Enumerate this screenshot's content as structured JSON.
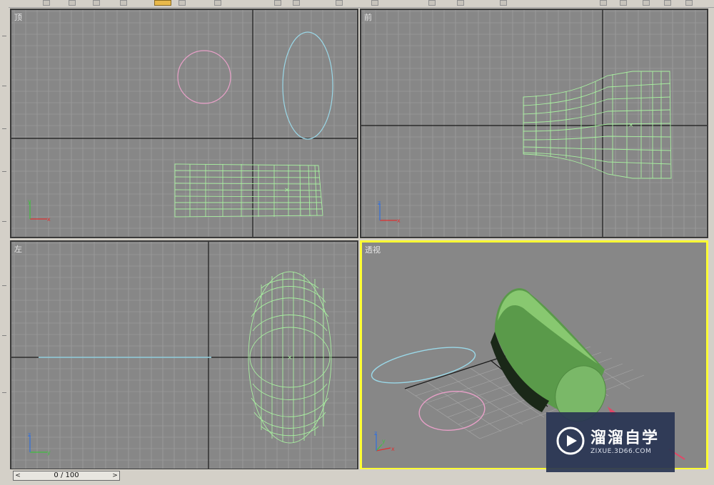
{
  "viewports": {
    "top": {
      "label": "顶"
    },
    "front": {
      "label": "前"
    },
    "left": {
      "label": "左"
    },
    "perspective": {
      "label": "透视"
    }
  },
  "axis_labels": {
    "x": "x",
    "y": "y",
    "z": "z"
  },
  "timeline": {
    "frame_display": "0 / 100",
    "prev_label": "<",
    "next_label": ">"
  },
  "watermark": {
    "brand": "溜溜自学",
    "url": "ZIXUE.3D66.COM"
  },
  "colors": {
    "active_viewport": "#ffff33",
    "viewport_bg": "#878787",
    "mesh": "#a8f0a0",
    "ellipse": "#9ad8e8",
    "circle": "#e8a0c8"
  },
  "toolbar": {
    "icons": [
      "select-icon",
      "move-icon",
      "rotate-icon",
      "scale-icon",
      "render-icon"
    ]
  }
}
